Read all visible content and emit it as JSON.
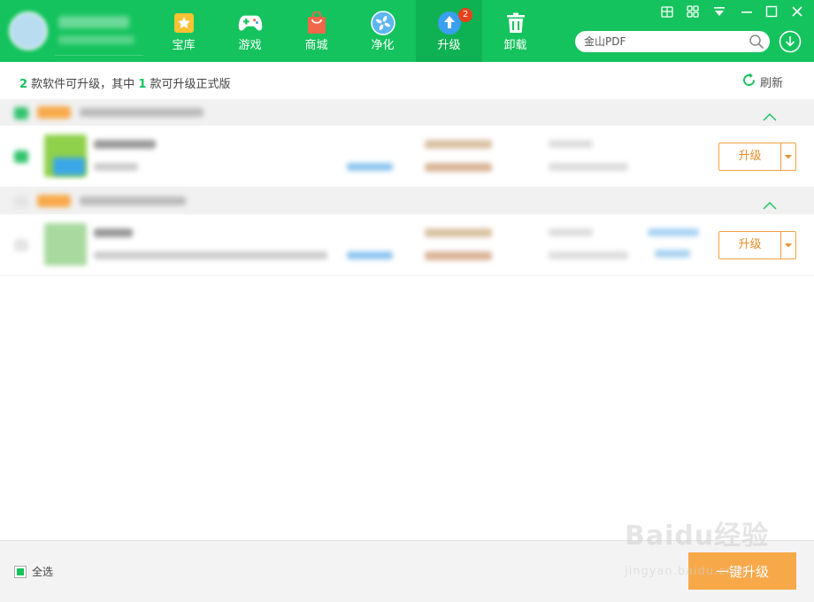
{
  "nav": {
    "items": [
      {
        "label": "宝库",
        "icon": "star-icon",
        "color": "#f7c233"
      },
      {
        "label": "游戏",
        "icon": "gamepad-icon",
        "color": "#ffffff"
      },
      {
        "label": "商城",
        "icon": "shopping-bag-icon",
        "color": "#f0674a"
      },
      {
        "label": "净化",
        "icon": "fan-icon",
        "color": "#5eb6ef"
      },
      {
        "label": "升级",
        "icon": "upload-arrow-icon",
        "color": "#3a9ff0",
        "badge": "2"
      },
      {
        "label": "卸载",
        "icon": "trash-icon",
        "color": "#ffffff"
      }
    ],
    "active_index": 4
  },
  "search": {
    "placeholder": "金山PDF"
  },
  "summary": {
    "count_total": "2",
    "text_a": " 款软件可升级，其中 ",
    "count_official": "1",
    "text_b": " 款可升级正式版"
  },
  "refresh_label": "刷新",
  "rows": [
    {
      "upgrade_label": "升级"
    },
    {
      "upgrade_label": "升级"
    }
  ],
  "footer": {
    "select_all_label": "全选",
    "one_click_label": "一键升级"
  },
  "watermark": {
    "logo": "Baidu经验",
    "sub": "jingyan.baidu.com"
  },
  "colors": {
    "brand_green": "#14c35d",
    "active_tab": "#0fb252",
    "upgrade_orange": "#f0a23e",
    "one_click_orange": "#f7a94a",
    "badge_red": "#e8401c"
  }
}
